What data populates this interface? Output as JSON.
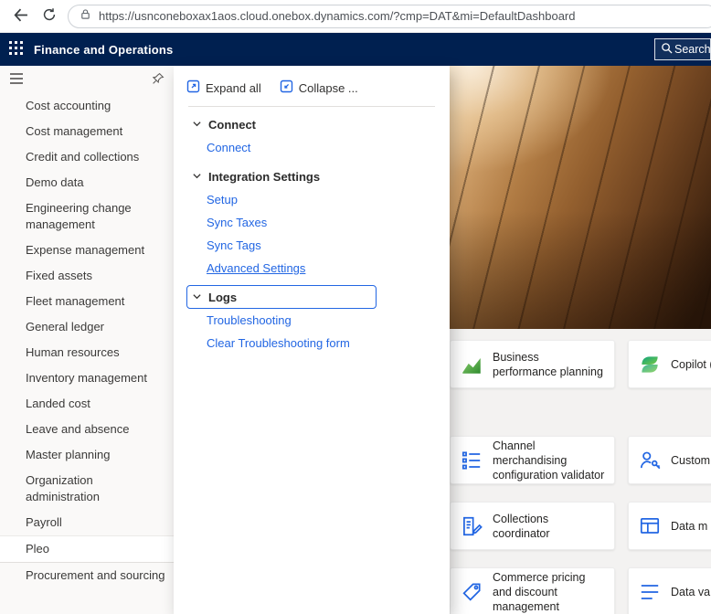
{
  "browser": {
    "url": "https://usnconeboxax1aos.cloud.onebox.dynamics.com/?cmp=DAT&mi=DefaultDashboard"
  },
  "navbar": {
    "title": "Finance and Operations",
    "search_label": "Search"
  },
  "colors": {
    "header_bg": "#002050",
    "accent_blue": "#2266e3",
    "tile_green": "#3f9c35"
  },
  "sidebar": {
    "items": [
      "Cost accounting",
      "Cost management",
      "Credit and collections",
      "Demo data",
      "Engineering change management",
      "Expense management",
      "Fixed assets",
      "Fleet management",
      "General ledger",
      "Human resources",
      "Inventory management",
      "Landed cost",
      "Leave and absence",
      "Master planning",
      "Organization administration",
      "Payroll",
      "Pleo",
      "Procurement and sourcing"
    ],
    "selected_item": "Pleo"
  },
  "flyout": {
    "expand_all": "Expand all",
    "collapse": "Collapse ...",
    "sections": [
      {
        "title": "Connect",
        "links": [
          "Connect"
        ]
      },
      {
        "title": "Integration Settings",
        "links": [
          "Setup",
          "Sync Taxes",
          "Sync Tags",
          "Advanced Settings"
        ]
      },
      {
        "title": "Logs",
        "focused": true,
        "links": [
          "Troubleshooting",
          "Clear Troubleshooting form"
        ]
      }
    ]
  },
  "main": {
    "tiles": [
      {
        "label": "Business performance planning",
        "icon": "area-chart-icon"
      },
      {
        "label": "Copilot (Previe",
        "icon": "copilot-icon"
      },
      {
        "label": "Channel merchandising configuration validator",
        "icon": "checklist-icon"
      },
      {
        "label": "Custom",
        "icon": "person-key-icon"
      },
      {
        "label": "Collections coordinator",
        "icon": "document-pencil-icon"
      },
      {
        "label": "Data m",
        "icon": "data-table-icon"
      },
      {
        "label": "Commerce pricing and discount management",
        "icon": "price-tag-icon"
      },
      {
        "label": "Data va",
        "icon": "list-icon"
      }
    ]
  }
}
